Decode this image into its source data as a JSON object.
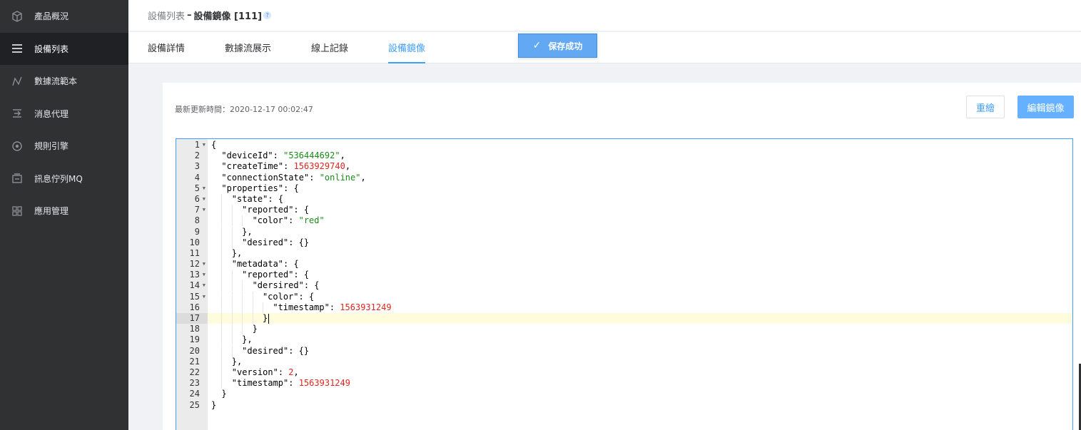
{
  "sidebar": {
    "items": [
      {
        "label": "產品概況",
        "icon": "cube-icon"
      },
      {
        "label": "設備列表",
        "icon": "list-icon",
        "active": true
      },
      {
        "label": "數據流範本",
        "icon": "flow-icon"
      },
      {
        "label": "消息代理",
        "icon": "proxy-icon"
      },
      {
        "label": "規則引擎",
        "icon": "engine-icon"
      },
      {
        "label": "訊息佇列MQ",
        "icon": "queue-icon"
      },
      {
        "label": "應用管理",
        "icon": "grid-icon"
      }
    ]
  },
  "header": {
    "breadcrumb_parent": "設備列表",
    "separator": "–",
    "current": "設備鏡像 [111]",
    "help_glyph": "?"
  },
  "tabs": [
    {
      "label": "設備詳情"
    },
    {
      "label": "數據流展示"
    },
    {
      "label": "線上記錄"
    },
    {
      "label": "設備鏡像",
      "active": true
    }
  ],
  "toast": {
    "text": "保存成功",
    "icon": "check-icon"
  },
  "card": {
    "updated_label": "最新更新時間：2020-12-17 00:02:47",
    "redraw_button": "重繪",
    "edit_button": "編輯鏡像"
  },
  "editor": {
    "current_line": 17,
    "lines": [
      {
        "n": "1",
        "fold": true,
        "text": "{"
      },
      {
        "n": "2",
        "text": "  \"deviceId\": \"536444692\","
      },
      {
        "n": "3",
        "text": "  \"createTime\": 1563929740,"
      },
      {
        "n": "4",
        "text": "  \"connectionState\": \"online\","
      },
      {
        "n": "5",
        "fold": true,
        "text": "  \"properties\": {"
      },
      {
        "n": "6",
        "fold": true,
        "text": "    \"state\": {"
      },
      {
        "n": "7",
        "fold": true,
        "text": "      \"reported\": {"
      },
      {
        "n": "8",
        "text": "        \"color\": \"red\""
      },
      {
        "n": "9",
        "text": "      },"
      },
      {
        "n": "10",
        "text": "      \"desired\": {}"
      },
      {
        "n": "11",
        "text": "    },"
      },
      {
        "n": "12",
        "fold": true,
        "text": "    \"metadata\": {"
      },
      {
        "n": "13",
        "fold": true,
        "text": "      \"reported\": {"
      },
      {
        "n": "14",
        "fold": true,
        "text": "        \"dersired\": {"
      },
      {
        "n": "15",
        "fold": true,
        "text": "          \"color\": {"
      },
      {
        "n": "16",
        "text": "            \"timestamp\": 1563931249"
      },
      {
        "n": "17",
        "text": "          }"
      },
      {
        "n": "18",
        "text": "        }"
      },
      {
        "n": "19",
        "text": "      },"
      },
      {
        "n": "20",
        "text": "      \"desired\": {}"
      },
      {
        "n": "21",
        "text": "    },"
      },
      {
        "n": "22",
        "text": "    \"version\": 2,"
      },
      {
        "n": "23",
        "text": "    \"timestamp\": 1563931249"
      },
      {
        "n": "24",
        "text": "  }"
      },
      {
        "n": "25",
        "text": "}"
      }
    ]
  },
  "colors": {
    "sidebar_bg": "#303133",
    "sidebar_active_bg": "#202124",
    "accent": "#409eff",
    "toast_bg": "#62a8f3",
    "string": "#1a8c1a",
    "number": "#e0261e"
  }
}
